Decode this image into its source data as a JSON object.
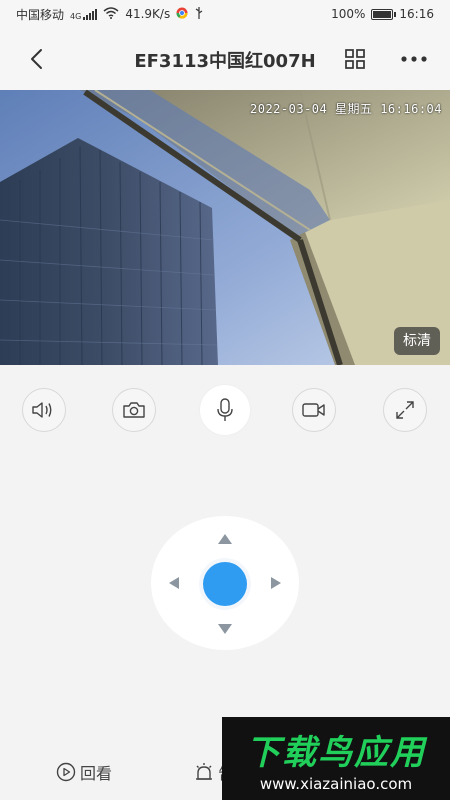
{
  "status_bar": {
    "carrier": "中国移动",
    "network_type": "4G",
    "speed": "41.9K/s",
    "battery": "100%",
    "battery_level": 1.0,
    "time": "16:16"
  },
  "header": {
    "title": "EF3113中国红007H",
    "back_icon": "chevron-left-icon",
    "grid_icon": "grid-icon",
    "more_icon": "more-dots-icon"
  },
  "video": {
    "timestamp": "2022-03-04 星期五 16:16:04",
    "quality_label": "标清"
  },
  "controls": {
    "items": [
      {
        "name": "speaker-icon"
      },
      {
        "name": "camera-icon"
      },
      {
        "name": "microphone-icon"
      },
      {
        "name": "video-record-icon"
      },
      {
        "name": "fullscreen-icon"
      }
    ]
  },
  "ptz": {
    "accent": "#2f9cf2"
  },
  "bottom": {
    "playback_label": "回看",
    "alarm_label": "告"
  },
  "watermark": {
    "title": "下载鸟应用",
    "url": "www.xiazainiao.com"
  }
}
